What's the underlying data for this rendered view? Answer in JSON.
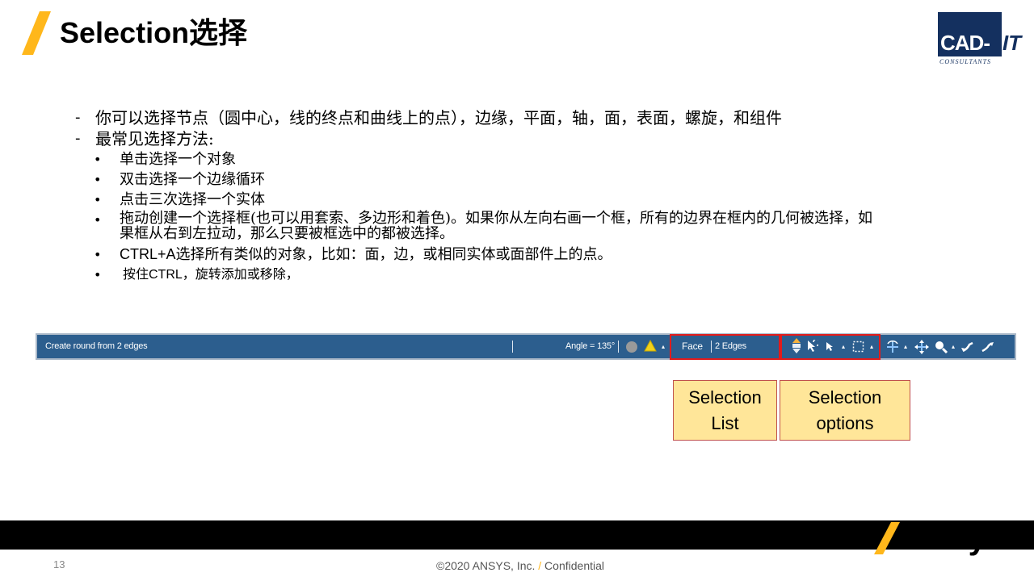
{
  "slide": {
    "title": "Selection选择",
    "page_number": "13",
    "copyright_left": "©2020 ANSYS, Inc. ",
    "copyright_slash": "/",
    "copyright_right": " Confidential"
  },
  "logo": {
    "cad": "CAD-",
    "it": "IT",
    "consultants": "CONSULTANTS"
  },
  "ansys_logo": {
    "wordmark": "Ansys"
  },
  "colors": {
    "accent_yellow": "#ffb71b",
    "statusbar_blue": "#2c5e8e",
    "highlight_red": "#e21b1b",
    "callout_fill": "#ffe699",
    "logo_navy": "#14305f"
  },
  "body": {
    "level1": [
      {
        "marker": "-",
        "text": "你可以选择节点（圆中心，线的终点和曲线上的点），边缘，平面，轴，面，表面，螺旋，和组件"
      },
      {
        "marker": "-",
        "text": "最常见选择方法:"
      }
    ],
    "level2": [
      {
        "marker": "•",
        "text": "单击选择一个对象"
      },
      {
        "marker": "•",
        "text": "双击选择一个边缘循环"
      },
      {
        "marker": "•",
        "text": "点击三次选择一个实体"
      },
      {
        "marker": "•",
        "text": "拖动创建一个选择框(也可以用套索、多边形和着色)。如果你从左向右画一个框，所有的边界在框内的几何被选择，如",
        "text2": "果框从右到左拉动，那么只要被框选中的都被选择。"
      },
      {
        "marker": "•",
        "prefix": "CTRL+A",
        "text": "选择所有类似的对象，比如：面，边，或相同实体或面部件上的点。"
      },
      {
        "marker": "•",
        "prefix": "按住CTRL",
        "text": "，旋转添加或移除，"
      }
    ]
  },
  "statusbar": {
    "message": "Create round from 2 edges",
    "angle": "Angle = 135°",
    "selection_type": "Face",
    "selection_count": "2 Edges"
  },
  "callouts": {
    "selection_list": [
      "Selection",
      "List"
    ],
    "selection_options": [
      "Selection",
      "options"
    ]
  }
}
